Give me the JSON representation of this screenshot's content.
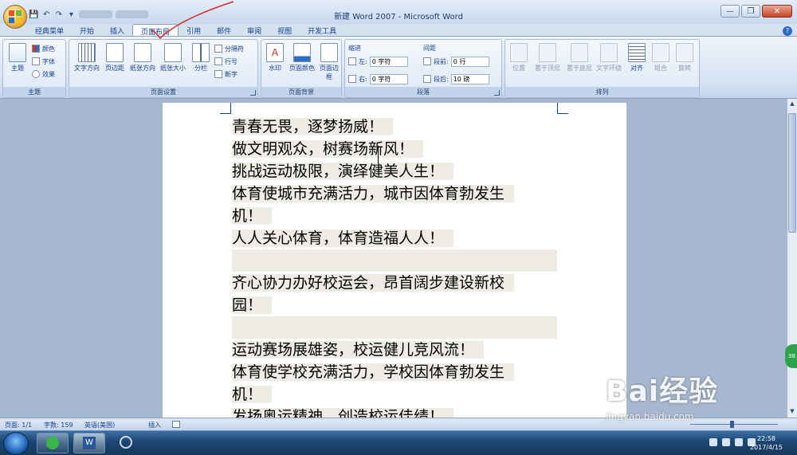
{
  "window": {
    "title": "新建 Word 2007 - Microsoft Word"
  },
  "tabs": [
    "经典菜单",
    "开始",
    "插入",
    "页面布局",
    "引用",
    "邮件",
    "审阅",
    "视图",
    "开发工具"
  ],
  "active_tab": "页面布局",
  "ribbon": {
    "theme": {
      "big": "主题",
      "items": [
        "颜色",
        "字体",
        "效果"
      ],
      "label": "主题"
    },
    "page_setup": {
      "buttons": [
        "文字方向",
        "页边距",
        "纸张方向",
        "纸张大小",
        "分栏"
      ],
      "small": [
        "分隔符",
        "行号",
        "断字"
      ],
      "label": "页面设置"
    },
    "background": {
      "buttons": [
        "水印",
        "页面颜色",
        "页面边框"
      ],
      "label": "页面背景"
    },
    "paragraph": {
      "indent_title": "缩进",
      "spacing_title": "间距",
      "left": "左:",
      "right": "右:",
      "left_val": "0 字符",
      "right_val": "0 字符",
      "before": "段前:",
      "after": "段后:",
      "before_val": "0 行",
      "after_val": "10 磅",
      "label": "段落"
    },
    "arrange": {
      "buttons": [
        "位置",
        "置于顶层",
        "置于底层",
        "文字环绕",
        "对齐",
        "组合",
        "旋转"
      ],
      "label": "排列"
    }
  },
  "document": {
    "lines": [
      "青春无畏，逐梦扬威！",
      "做文明观众，树赛场新风！",
      "挑战运动极限，演绎健美人生！",
      "体育使城市充满活力，城市因体育勃发生",
      "机！",
      "人人关心体育，体育造福人人！",
      "",
      "齐心协力办好校运会，昂首阔步建设新校",
      "园！",
      "",
      "运动赛场展雄姿，校运健儿竞风流！",
      "体育使学校充满活力，学校因体育勃发生",
      "机！",
      "发扬奥运精神，创造校运佳绩！"
    ],
    "highlight_color": "#eeece4"
  },
  "status": {
    "page": "页面: 1/1",
    "words": "字数: 159",
    "language": "英语(美国)",
    "mode": "插入"
  },
  "taskbar": {
    "time": "22:58",
    "date": "2017/4/15"
  },
  "watermark": {
    "brand": "Bai经验",
    "url": "jingyan.baidu.com"
  },
  "side_badge": "38"
}
